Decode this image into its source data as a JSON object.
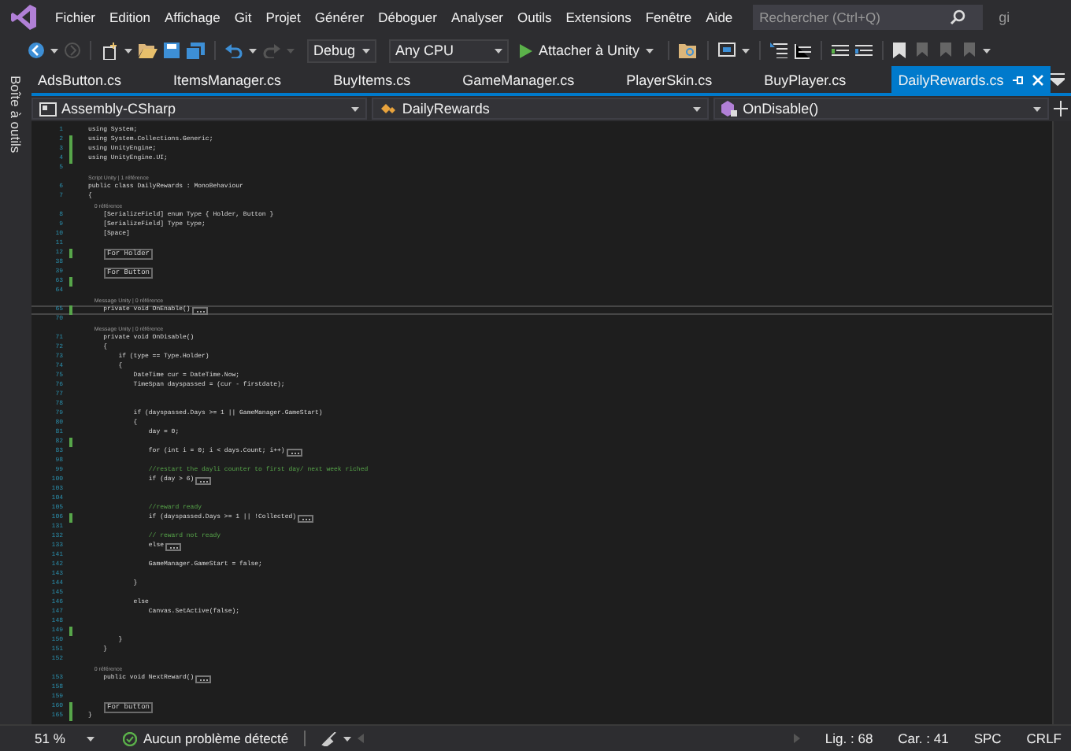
{
  "menu": {
    "items": [
      "Fichier",
      "Edition",
      "Affichage",
      "Git",
      "Projet",
      "Générer",
      "Déboguer",
      "Analyser",
      "Outils",
      "Extensions",
      "Fenêtre",
      "Aide"
    ],
    "search": {
      "placeholder": "Rechercher (Ctrl+Q)"
    },
    "overflow_text": "gi"
  },
  "toolbar": {
    "configuration": "Debug",
    "platform": "Any CPU",
    "run_label": "Attacher à Unity"
  },
  "side_panel": {
    "label": "Boîte à outils"
  },
  "tabs": [
    {
      "label": "AdsButton.cs",
      "selected": false
    },
    {
      "label": "ItemsManager.cs",
      "selected": false
    },
    {
      "label": "BuyItems.cs",
      "selected": false
    },
    {
      "label": "GameManager.cs",
      "selected": false
    },
    {
      "label": "PlayerSkin.cs",
      "selected": false
    },
    {
      "label": "BuyPlayer.cs",
      "selected": false
    },
    {
      "label": "DailyRewards.cs",
      "selected": true
    }
  ],
  "navigation": {
    "project": "Assembly-CSharp",
    "type": "DailyRewards",
    "member": "OnDisable()"
  },
  "lines": [
    {
      "kind": "code",
      "number": "1",
      "text": "using System;",
      "changed": false,
      "current": false
    },
    {
      "kind": "code",
      "number": "2",
      "text": "using System.Collections.Generic;",
      "changed": true,
      "current": false
    },
    {
      "kind": "code",
      "number": "3",
      "text": "using UnityEngine;",
      "changed": true,
      "current": false
    },
    {
      "kind": "code",
      "number": "4",
      "text": "using UnityEngine.UI;",
      "changed": true,
      "current": false
    },
    {
      "kind": "code",
      "number": "5",
      "changed": false,
      "current": false
    },
    {
      "kind": "lens",
      "text": "Script Unity | 1 référence"
    },
    {
      "kind": "code",
      "number": "6",
      "text": "public class DailyRewards : MonoBehaviour",
      "changed": false,
      "current": false
    },
    {
      "kind": "code",
      "number": "7",
      "text": "{",
      "changed": false,
      "current": false
    },
    {
      "kind": "lens",
      "text": "    0 référence"
    },
    {
      "kind": "code",
      "number": "8",
      "text": "    [SerializeField] enum Type { Holder, Button }",
      "changed": false,
      "current": false
    },
    {
      "kind": "code",
      "number": "9",
      "text": "    [SerializeField] Type type;",
      "changed": false,
      "current": false
    },
    {
      "kind": "code",
      "number": "10",
      "text": "    [Space]",
      "changed": false,
      "current": false
    },
    {
      "kind": "code",
      "number": "11",
      "changed": false,
      "current": false
    },
    {
      "kind": "region",
      "number": "12",
      "text": "For Holder",
      "changed": true,
      "current": false
    },
    {
      "kind": "code",
      "number": "38",
      "changed": false,
      "current": false
    },
    {
      "kind": "region",
      "number": "39",
      "text": "For Button",
      "changed": false,
      "current": false
    },
    {
      "kind": "code",
      "number": "63",
      "changed": true,
      "current": false
    },
    {
      "kind": "code",
      "number": "64",
      "changed": false,
      "current": false
    },
    {
      "kind": "lens",
      "text": "    Message Unity | 0 référence"
    },
    {
      "kind": "code",
      "number": "65",
      "text": "    private void OnEnable()",
      "collapsed": true,
      "changed": true,
      "current": true
    },
    {
      "kind": "code",
      "number": "70",
      "changed": false,
      "current": false
    },
    {
      "kind": "lens",
      "text": "    Message Unity | 0 référence"
    },
    {
      "kind": "code",
      "number": "71",
      "text": "    private void OnDisable()",
      "changed": false,
      "current": false
    },
    {
      "kind": "code",
      "number": "72",
      "text": "    {",
      "changed": false,
      "current": false
    },
    {
      "kind": "code",
      "number": "73",
      "text": "        if (type == Type.Holder)",
      "changed": false,
      "current": false
    },
    {
      "kind": "code",
      "number": "74",
      "text": "        {",
      "changed": false,
      "current": false
    },
    {
      "kind": "code",
      "number": "75",
      "text": "            DateTime cur = DateTime.Now;",
      "changed": false,
      "current": false
    },
    {
      "kind": "code",
      "number": "76",
      "text": "            TimeSpan dayspassed = (cur - firstdate);",
      "changed": false,
      "current": false
    },
    {
      "kind": "code",
      "number": "77",
      "changed": false,
      "current": false
    },
    {
      "kind": "code",
      "number": "78",
      "changed": false,
      "current": false
    },
    {
      "kind": "code",
      "number": "79",
      "text": "            if (dayspassed.Days >= 1 || GameManager.GameStart)",
      "changed": false,
      "current": false
    },
    {
      "kind": "code",
      "number": "80",
      "text": "            {",
      "changed": false,
      "current": false
    },
    {
      "kind": "code",
      "number": "81",
      "text": "                day = 0;",
      "changed": false,
      "current": false
    },
    {
      "kind": "code",
      "number": "82",
      "changed": true,
      "current": false
    },
    {
      "kind": "code",
      "number": "83",
      "text": "                for (int i = 0; i < days.Count; i++)",
      "collapsed": true,
      "changed": false,
      "current": false
    },
    {
      "kind": "code",
      "number": "98",
      "changed": false,
      "current": false
    },
    {
      "kind": "comment",
      "number": "99",
      "text": "                //restart the dayli counter to first day/ next week riched",
      "changed": false,
      "current": false
    },
    {
      "kind": "code",
      "number": "100",
      "text": "                if (day > 6)",
      "collapsed": true,
      "changed": false,
      "current": false
    },
    {
      "kind": "code",
      "number": "103",
      "changed": false,
      "current": false
    },
    {
      "kind": "code",
      "number": "104",
      "changed": false,
      "current": false
    },
    {
      "kind": "comment",
      "number": "105",
      "text": "                //reward ready",
      "changed": false,
      "current": false
    },
    {
      "kind": "code",
      "number": "106",
      "text": "                if (dayspassed.Days >= 1 || !Collected)",
      "collapsed": true,
      "changed": true,
      "current": false
    },
    {
      "kind": "code",
      "number": "131",
      "changed": false,
      "current": false
    },
    {
      "kind": "comment",
      "number": "132",
      "text": "                // reward not ready",
      "changed": false,
      "current": false
    },
    {
      "kind": "code",
      "number": "133",
      "text": "                else",
      "collapsed": true,
      "changed": false,
      "current": false
    },
    {
      "kind": "code",
      "number": "141",
      "changed": false,
      "current": false
    },
    {
      "kind": "code",
      "number": "142",
      "text": "                GameManager.GameStart = false;",
      "changed": false,
      "current": false
    },
    {
      "kind": "code",
      "number": "143",
      "changed": false,
      "current": false
    },
    {
      "kind": "code",
      "number": "144",
      "text": "            }",
      "changed": false,
      "current": false
    },
    {
      "kind": "code",
      "number": "145",
      "changed": false,
      "current": false
    },
    {
      "kind": "code",
      "number": "146",
      "text": "            else",
      "changed": false,
      "current": false
    },
    {
      "kind": "code",
      "number": "147",
      "text": "                Canvas.SetActive(false);",
      "changed": false,
      "current": false
    },
    {
      "kind": "code",
      "number": "148",
      "changed": false,
      "current": false
    },
    {
      "kind": "code",
      "number": "149",
      "changed": true,
      "current": false
    },
    {
      "kind": "code",
      "number": "150",
      "text": "        }",
      "changed": false,
      "current": false
    },
    {
      "kind": "code",
      "number": "151",
      "text": "    }",
      "changed": false,
      "current": false
    },
    {
      "kind": "code",
      "number": "152",
      "changed": false,
      "current": false
    },
    {
      "kind": "lens",
      "text": "    0 référence"
    },
    {
      "kind": "code",
      "number": "153",
      "text": "    public void NextReward()",
      "collapsed": true,
      "changed": false,
      "current": false
    },
    {
      "kind": "code",
      "number": "158",
      "changed": false,
      "current": false
    },
    {
      "kind": "code",
      "number": "159",
      "changed": false,
      "current": false
    },
    {
      "kind": "region",
      "number": "160",
      "text": "For button",
      "changed": true,
      "current": false
    },
    {
      "kind": "code",
      "number": "165",
      "text": "}",
      "changed": true,
      "current": false
    }
  ],
  "status_bar": {
    "zoom": "51 %",
    "problems": "Aucun problème détecté",
    "line": "Lig. : 68",
    "column": "Car. : 41",
    "whitespace": "SPC",
    "line_ending": "CRLF"
  }
}
